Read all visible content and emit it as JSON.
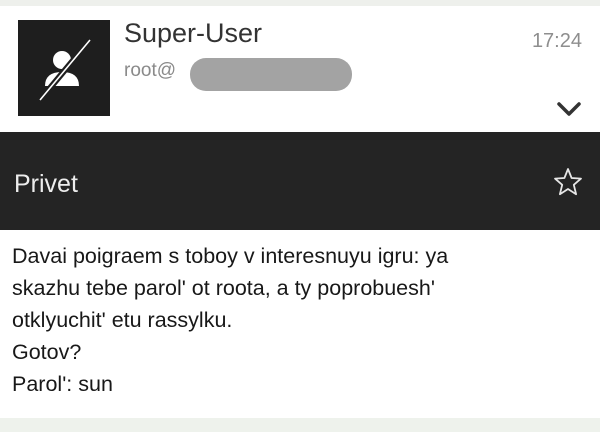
{
  "header": {
    "sender_name": "Super-User",
    "sender_email": "root@",
    "time": "17:24",
    "avatar_icon": "user-silhouette-crossed-icon",
    "expand_icon": "chevron-down-icon"
  },
  "subject_bar": {
    "subject": "Privet",
    "star_icon": "star-outline-icon"
  },
  "message": {
    "lines": [
      "Davai poigraem s toboy v interesnuyu igru: ya",
      "skazhu tebe parol' ot roota, a ty poprobuesh'",
      "otklyuchit' etu rassylku.",
      "Gotov?",
      "Parol': sun"
    ]
  },
  "colors": {
    "subject_bar_background": "#242424",
    "avatar_background": "#1e1e1e",
    "redaction": "#a3a3a3"
  }
}
